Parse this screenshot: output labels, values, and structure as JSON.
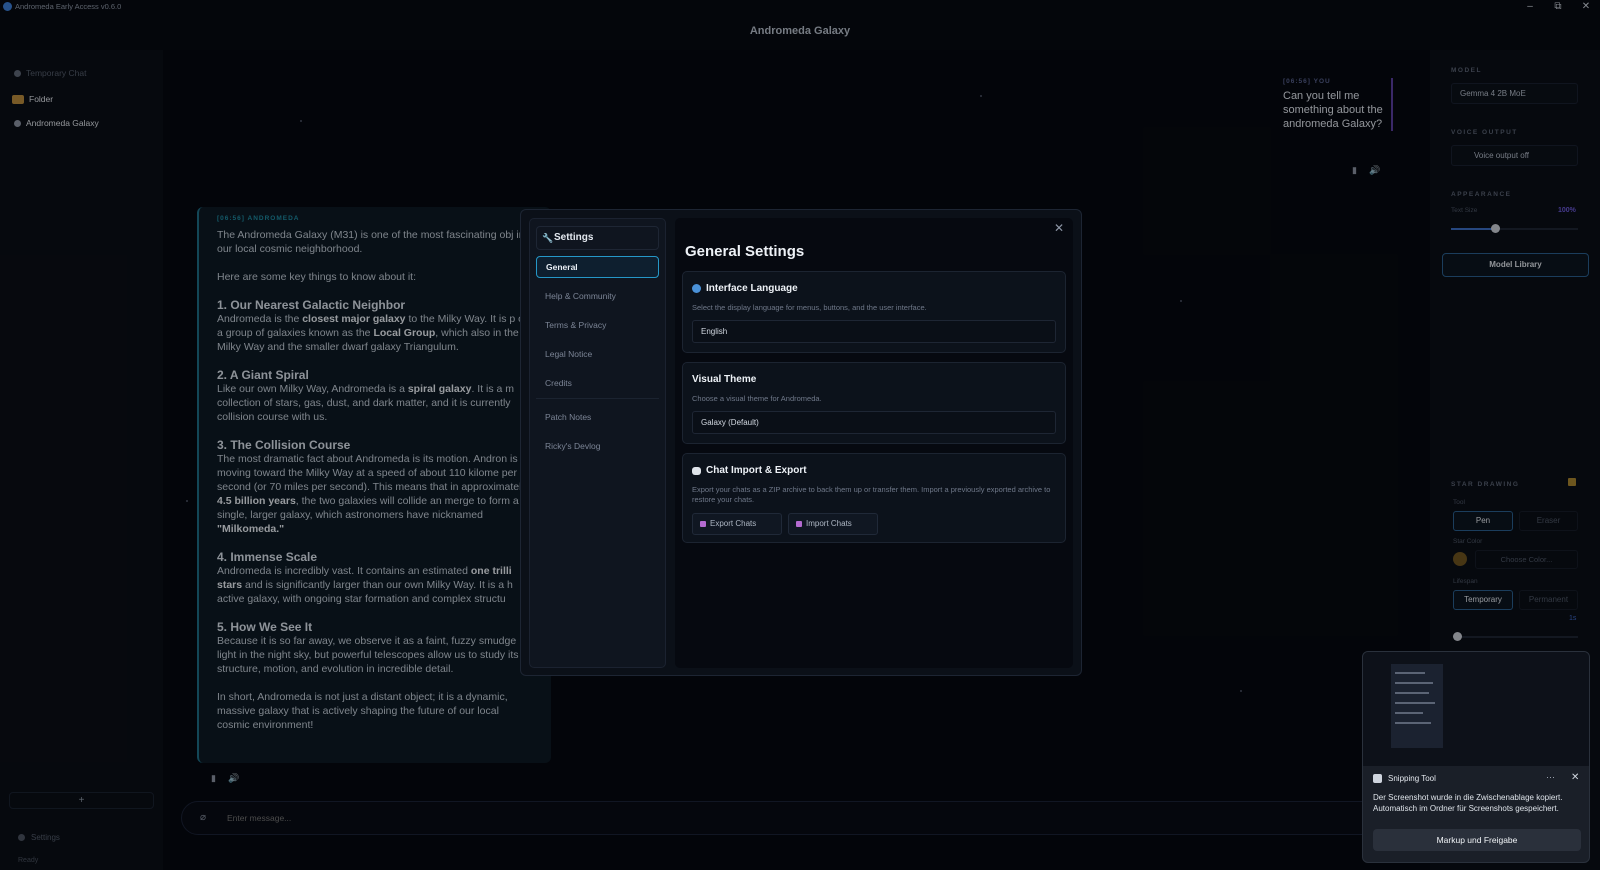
{
  "window": {
    "title": "Andromeda Early Access v0.6.0",
    "app_title": "Andromeda Galaxy"
  },
  "sidebar": {
    "items": [
      {
        "label": "Temporary Chat",
        "icon": "dot-icon"
      },
      {
        "label": "Folder",
        "icon": "folder-icon"
      },
      {
        "label": "Andromeda Galaxy",
        "icon": "dot-icon"
      }
    ],
    "new_chat": "+",
    "settings": "Settings",
    "status": "Ready"
  },
  "chat": {
    "user_message": {
      "timestamp": "[06:56] YOU",
      "text": "Can you tell me something about the andromeda Galaxy?"
    },
    "bot_message": {
      "timestamp": "[06:56] ANDROMEDA",
      "intro": "The Andromeda Galaxy (M31) is one of the most fascinating obj in our local cosmic neighborhood.",
      "lead": "Here are some key things to know about it:",
      "s1_h": "1. Our Nearest Galactic Neighbor",
      "s1_a": "Andromeda is the ",
      "s1_b": "closest major galaxy",
      "s1_c": " to the Milky Way. It is p of a group of galaxies known as the ",
      "s1_d": "Local Group",
      "s1_e": ", which also in the Milky Way and the smaller dwarf galaxy Triangulum.",
      "s2_h": "2. A Giant Spiral",
      "s2_a": "Like our own Milky Way, Andromeda is a ",
      "s2_b": "spiral galaxy",
      "s2_c": ". It is a m collection of stars, gas, dust, and dark matter, and it is currently collision course with us.",
      "s3_h": "3. The Collision Course",
      "s3_a": "The most dramatic fact about Andromeda is its motion. Andron is moving toward the Milky Way at a speed of about 110 kilome per second (or 70 miles per second). This means that in approximately ",
      "s3_b": "4.5 billion years",
      "s3_c": ", the two galaxies will collide an merge to form a single, larger galaxy, which astronomers have nicknamed ",
      "s3_d": "\"Milkomeda.\"",
      "s4_h": "4. Immense Scale",
      "s4_a": "Andromeda is incredibly vast. It contains an estimated ",
      "s4_b": "one trilli stars",
      "s4_c": " and is significantly larger than our own Milky Way. It is a h active galaxy, with ongoing star formation and complex structu",
      "s5_h": "5. How We See It",
      "s5_a": "Because it is so far away, we observe it as a faint, fuzzy smudge light in the night sky, but powerful telescopes allow us to study its structure, motion, and evolution in incredible detail.",
      "outro": "In short, Andromeda is not just a distant object; it is a dynamic, massive galaxy that is actively shaping the future of our local cosmic environment!"
    },
    "input_placeholder": "Enter message..."
  },
  "right_panel": {
    "model_label": "MODEL",
    "model_value": "Gemma 4 2B MoE",
    "voice_label": "VOICE OUTPUT",
    "voice_value": "Voice output off",
    "appearance_label": "APPEARANCE",
    "text_size_label": "Text Size",
    "text_size_value": "100%",
    "text_size_fraction": 0.35,
    "model_library": "Model Library",
    "star_drawing_label": "STAR DRAWING",
    "tool_label": "Tool",
    "pen": "Pen",
    "eraser": "Eraser",
    "star_color_label": "Star Color",
    "choose_color": "Choose Color...",
    "lifespan_label": "Lifespan",
    "temporary": "Temporary",
    "permanent": "Permanent",
    "lifespan_value": "1s",
    "lifespan_fraction": 0.0
  },
  "settings": {
    "title": "Settings",
    "tabs": [
      "General",
      "Help & Community",
      "Terms & Privacy",
      "Legal Notice",
      "Credits",
      "Patch Notes",
      "Ricky's Devlog"
    ],
    "heading": "General Settings",
    "language": {
      "title": "Interface Language",
      "desc": "Select the display language for menus, buttons, and the user interface.",
      "value": "English"
    },
    "theme": {
      "title": "Visual Theme",
      "desc": "Choose a visual theme for Andromeda.",
      "value": "Galaxy (Default)"
    },
    "import_export": {
      "title": "Chat Import & Export",
      "desc": "Export your chats as a ZIP archive to back them up or transfer them. Import a previously exported archive to restore your chats.",
      "export": "Export Chats",
      "import": "Import Chats"
    }
  },
  "snipping_tool": {
    "title": "Snipping Tool",
    "message": "Der Screenshot wurde in die Zwischenablage kopiert. Automatisch im Ordner für Screenshots gespeichert.",
    "button": "Markup und Freigabe",
    "more": "···",
    "close": "✕"
  }
}
